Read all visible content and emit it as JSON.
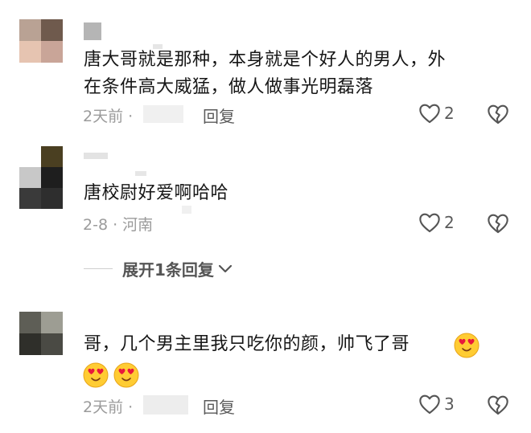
{
  "comments": [
    {
      "text_line1": "唐大哥就是那种，本身就是个好人的男人，外",
      "text_line2": "在条件高大威猛，做人做事光明磊落",
      "time": "2天前 ·",
      "reply_label": "回复",
      "likes": "2"
    },
    {
      "text_line1": "唐校尉好爱啊哈哈",
      "time": "2-8 · 河南",
      "likes": "2",
      "expand_label": "展开1条回复"
    },
    {
      "text_line1": "哥，几个男主里我只吃你的颜，帅飞了哥",
      "time": "2天前 ·",
      "reply_label": "回复",
      "likes": "3"
    }
  ],
  "icons": {
    "like": "heart-outline-icon",
    "dislike": "broken-heart-icon",
    "expand": "chevron-down-icon",
    "emoji": "smiling-face-with-heart-eyes-icon"
  },
  "colors": {
    "text": "#161616",
    "meta": "#9b9b9b",
    "icon": "#555555"
  }
}
